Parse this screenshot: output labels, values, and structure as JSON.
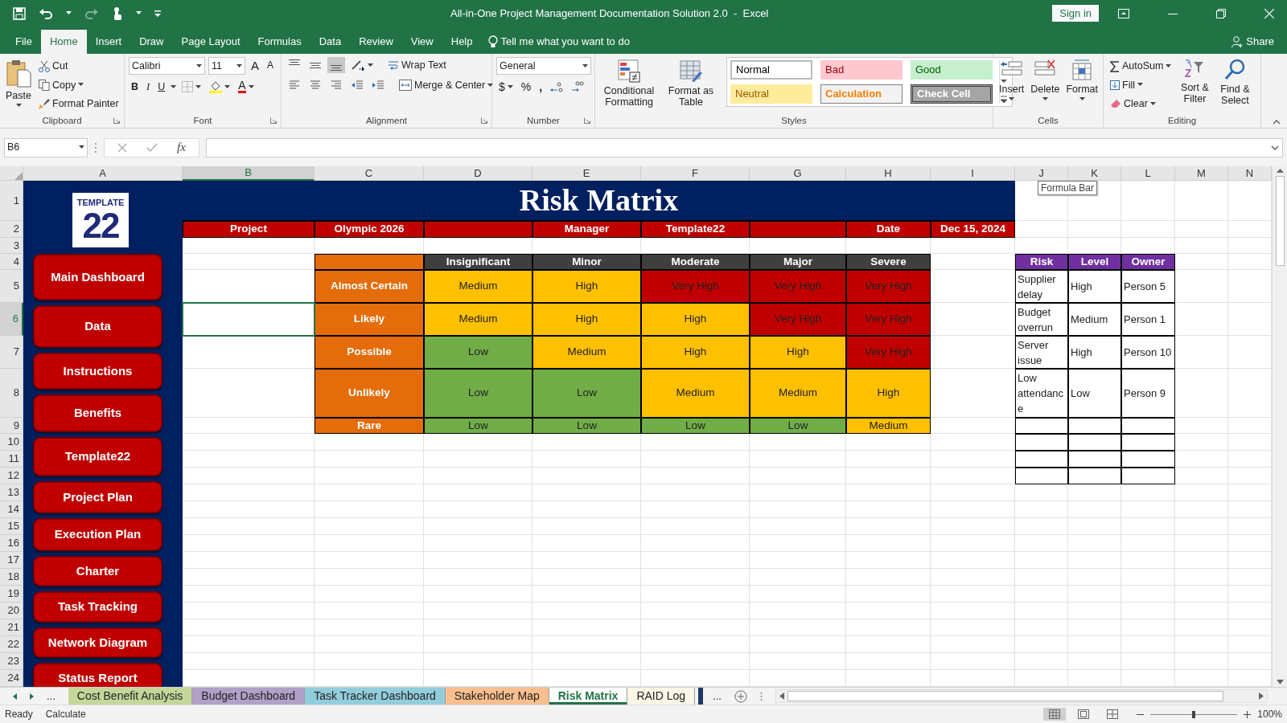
{
  "window": {
    "title": "All-in-One Project Management Documentation Solution 2.0  -  Excel",
    "sign_in": "Sign in"
  },
  "menu_tabs": [
    {
      "label": "File",
      "selected": false
    },
    {
      "label": "Home",
      "selected": true
    },
    {
      "label": "Insert",
      "selected": false
    },
    {
      "label": "Draw",
      "selected": false
    },
    {
      "label": "Page Layout",
      "selected": false
    },
    {
      "label": "Formulas",
      "selected": false
    },
    {
      "label": "Data",
      "selected": false
    },
    {
      "label": "Review",
      "selected": false
    },
    {
      "label": "View",
      "selected": false
    },
    {
      "label": "Help",
      "selected": false
    }
  ],
  "tell_me": "Tell me what you want to do",
  "share": "Share",
  "ribbon": {
    "clipboard": {
      "paste": "Paste",
      "cut": "Cut",
      "copy": "Copy",
      "format_painter": "Format Painter",
      "label": "Clipboard"
    },
    "font": {
      "name": "Calibri",
      "size": "11",
      "grow": "A",
      "shrink": "A",
      "bold": "B",
      "italic": "I",
      "underline": "U",
      "color_letter": "A",
      "label": "Font"
    },
    "alignment": {
      "vertical": [
        {
          "kind": "top",
          "selected": false
        },
        {
          "kind": "middle",
          "selected": false
        },
        {
          "kind": "bottom",
          "selected": true
        }
      ],
      "wrap_text": "Wrap Text",
      "merge_center": "Merge & Center",
      "label": "Alignment"
    },
    "number": {
      "format": "General",
      "currency": "$",
      "percent": "%",
      "comma": ",",
      "label": "Number"
    },
    "styles": {
      "conditional": "Conditional Formatting",
      "format_table": "Format as Table",
      "cell_styles": [
        {
          "label": "Normal",
          "kind": "normal"
        },
        {
          "label": "Bad",
          "kind": "bad"
        },
        {
          "label": "Good",
          "kind": "good"
        },
        {
          "label": "Neutral",
          "kind": "neutral"
        },
        {
          "label": "Calculation",
          "kind": "calculation"
        },
        {
          "label": "Check Cell",
          "kind": "check"
        }
      ],
      "label": "Styles"
    },
    "cells": {
      "buttons": [
        {
          "label": "Insert",
          "kind": "insert"
        },
        {
          "label": "Delete",
          "kind": "delete"
        },
        {
          "label": "Format",
          "kind": "format"
        }
      ],
      "label": "Cells"
    },
    "editing": {
      "autosum": "AutoSum",
      "fill": "Fill",
      "clear": "Clear",
      "sort": "Sort & Filter",
      "find": "Find & Select",
      "label": "Editing"
    }
  },
  "formula_bar": {
    "name_box": "B6",
    "function_label": "fx",
    "tooltip": "Formula Bar"
  },
  "columns": [
    {
      "label": "A",
      "selected": false
    },
    {
      "label": "B",
      "selected": true
    },
    {
      "label": "C",
      "selected": false
    },
    {
      "label": "D",
      "selected": false
    },
    {
      "label": "E",
      "selected": false
    },
    {
      "label": "F",
      "selected": false
    },
    {
      "label": "G",
      "selected": false
    },
    {
      "label": "H",
      "selected": false
    },
    {
      "label": "I",
      "selected": false
    },
    {
      "label": "J",
      "selected": false
    },
    {
      "label": "K",
      "selected": false
    },
    {
      "label": "L",
      "selected": false
    },
    {
      "label": "M",
      "selected": false
    },
    {
      "label": "N",
      "selected": false
    }
  ],
  "rows": [
    {
      "label": "1",
      "selected": false
    },
    {
      "label": "2",
      "selected": false
    },
    {
      "label": "3",
      "selected": false
    },
    {
      "label": "4",
      "selected": false
    },
    {
      "label": "5",
      "selected": false
    },
    {
      "label": "6",
      "selected": true
    },
    {
      "label": "7",
      "selected": false
    },
    {
      "label": "8",
      "selected": false
    },
    {
      "label": "9",
      "selected": false
    },
    {
      "label": "10",
      "selected": false
    },
    {
      "label": "11",
      "selected": false
    },
    {
      "label": "12",
      "selected": false
    },
    {
      "label": "13",
      "selected": false
    },
    {
      "label": "14",
      "selected": false
    },
    {
      "label": "15",
      "selected": false
    },
    {
      "label": "16",
      "selected": false
    },
    {
      "label": "17",
      "selected": false
    },
    {
      "label": "18",
      "selected": false
    },
    {
      "label": "19",
      "selected": false
    },
    {
      "label": "20",
      "selected": false
    },
    {
      "label": "21",
      "selected": false
    },
    {
      "label": "22",
      "selected": false
    },
    {
      "label": "23",
      "selected": false
    },
    {
      "label": "24",
      "selected": false
    }
  ],
  "sidebar": {
    "logo": {
      "number": "22",
      "word": "TEMPLATE"
    },
    "buttons": [
      "Main Dashboard",
      "Data",
      "Instructions",
      "Benefits",
      "Template22",
      "Project Plan",
      "Execution Plan",
      "Charter",
      "Task Tracking",
      "Network Diagram",
      "Status Report"
    ]
  },
  "sheet": {
    "title": "Risk Matrix",
    "info": [
      {
        "label": "Project",
        "value": "Olympic 2026"
      },
      {
        "label": "Manager",
        "value": "Template22"
      },
      {
        "label": "Date",
        "value": "Dec 15, 2024"
      }
    ],
    "matrix": {
      "columns": [
        "Insignificant",
        "Minor",
        "Moderate",
        "Major",
        "Severe"
      ],
      "rows": [
        {
          "label": "Almost Certain",
          "cells": [
            {
              "text": "Medium",
              "color": "#ffc000"
            },
            {
              "text": "High",
              "color": "#ffc000"
            },
            {
              "text": "Very High",
              "color": "#c00000"
            },
            {
              "text": "Very High",
              "color": "#c00000"
            },
            {
              "text": "Very High",
              "color": "#c00000"
            }
          ]
        },
        {
          "label": "Likely",
          "cells": [
            {
              "text": "Medium",
              "color": "#ffc000"
            },
            {
              "text": "High",
              "color": "#ffc000"
            },
            {
              "text": "High",
              "color": "#ffc000"
            },
            {
              "text": "Very High",
              "color": "#c00000"
            },
            {
              "text": "Very High",
              "color": "#c00000"
            }
          ]
        },
        {
          "label": "Possible",
          "cells": [
            {
              "text": "Low",
              "color": "#70ad47"
            },
            {
              "text": "Medium",
              "color": "#ffc000"
            },
            {
              "text": "High",
              "color": "#ffc000"
            },
            {
              "text": "High",
              "color": "#ffc000"
            },
            {
              "text": "Very High",
              "color": "#c00000"
            }
          ]
        },
        {
          "label": "Unlikely",
          "cells": [
            {
              "text": "Low",
              "color": "#70ad47"
            },
            {
              "text": "Low",
              "color": "#70ad47"
            },
            {
              "text": "Medium",
              "color": "#ffc000"
            },
            {
              "text": "Medium",
              "color": "#ffc000"
            },
            {
              "text": "High",
              "color": "#ffc000"
            }
          ]
        },
        {
          "label": "Rare",
          "cells": [
            {
              "text": "Low",
              "color": "#70ad47"
            },
            {
              "text": "Low",
              "color": "#70ad47"
            },
            {
              "text": "Low",
              "color": "#70ad47"
            },
            {
              "text": "Low",
              "color": "#70ad47"
            },
            {
              "text": "Medium",
              "color": "#ffc000"
            }
          ]
        }
      ]
    },
    "risk_register": {
      "columns": [
        "Risk",
        "Level",
        "Owner"
      ],
      "rows": [
        {
          "risk": "Supplier delay",
          "rating": "High",
          "owner": "Person 5"
        },
        {
          "risk": "Budget overrun",
          "rating": "Medium",
          "owner": "Person 1"
        },
        {
          "risk": "Server issue",
          "rating": "High",
          "owner": "Person 10"
        },
        {
          "risk": "Low attendance",
          "rating": "Low",
          "owner": "Person 9"
        }
      ]
    }
  },
  "sheet_tabs": [
    {
      "label": "Cost Benefit Analysis",
      "color": "#c4d79b",
      "selected": false
    },
    {
      "label": "Budget Dashboard",
      "color": "#b1a0c7",
      "selected": false
    },
    {
      "label": "Task Tracker Dashboard",
      "color": "#92cddc",
      "selected": false
    },
    {
      "label": "Stakeholder Map",
      "color": "#fabf8f",
      "selected": false
    },
    {
      "label": "Risk Matrix",
      "color": "#ffffff",
      "selected": true
    },
    {
      "label": "RAID Log",
      "color": "#fbf6e6",
      "selected": false
    }
  ],
  "tab_more": "...",
  "tab_more_right": "...",
  "status_bar": {
    "ready": "Ready",
    "calculate": "Calculate",
    "views": [
      {
        "kind": "normal",
        "selected": true
      },
      {
        "kind": "page_layout",
        "selected": false
      },
      {
        "kind": "page_break",
        "selected": false
      }
    ],
    "zoom": {
      "level": 0.5,
      "reading": "100%"
    }
  }
}
